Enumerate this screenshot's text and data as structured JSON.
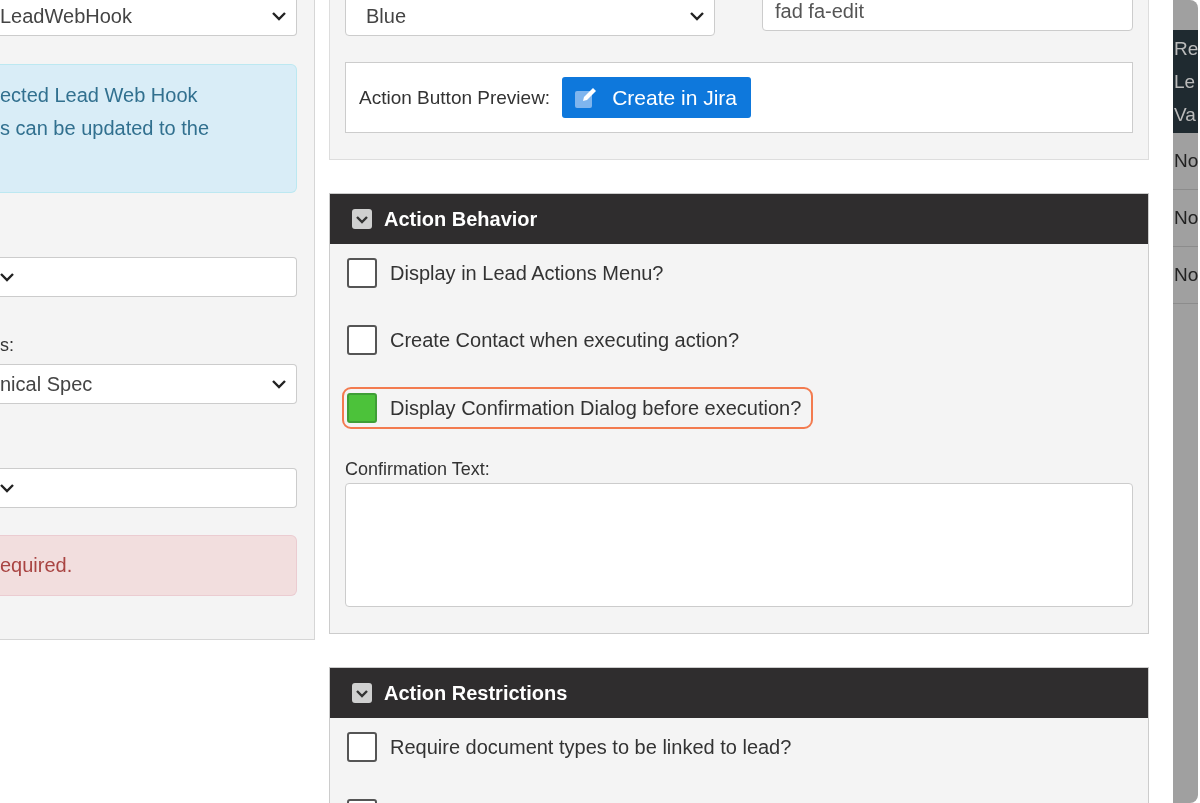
{
  "left_panel": {
    "items": [
      {
        "kind": "select",
        "value": "LeadWebHook"
      },
      {
        "kind": "info",
        "lines": [
          "ected Lead Web Hook",
          "s can be updated to the"
        ]
      },
      {
        "kind": "select"
      },
      {
        "kind": "label",
        "text": "s:"
      },
      {
        "kind": "select",
        "value": "nical Spec"
      },
      {
        "kind": "select"
      },
      {
        "kind": "error",
        "text": "equired."
      }
    ]
  },
  "appearance": {
    "color_select": {
      "value": "Blue"
    },
    "icon_field": {
      "value": "fad fa-edit"
    },
    "preview": {
      "label": "Action Button Preview:",
      "button": "Create in Jira"
    }
  },
  "sections": [
    {
      "title": "Action Behavior",
      "items": [
        {
          "kind": "checkbox",
          "label": "Display in Lead Actions Menu?",
          "checked": false,
          "highlighted": false
        },
        {
          "kind": "checkbox",
          "label": "Create Contact when executing action?",
          "checked": false,
          "highlighted": false
        },
        {
          "kind": "checkbox",
          "label": "Display Confirmation Dialog before execution?",
          "checked": true,
          "highlighted": true
        },
        {
          "kind": "textarea",
          "label": "Confirmation Text:"
        }
      ]
    },
    {
      "title": "Action Restrictions",
      "items": [
        {
          "kind": "checkbox",
          "label": "Require document types to be linked to lead?",
          "checked": false,
          "highlighted": false
        },
        {
          "kind": "checkbox",
          "checked": false,
          "highlighted": false
        }
      ]
    }
  ],
  "background_table": {
    "header_lines": [
      "Re",
      "Le",
      "Va"
    ],
    "rows": [
      "No",
      "No",
      "No"
    ]
  }
}
